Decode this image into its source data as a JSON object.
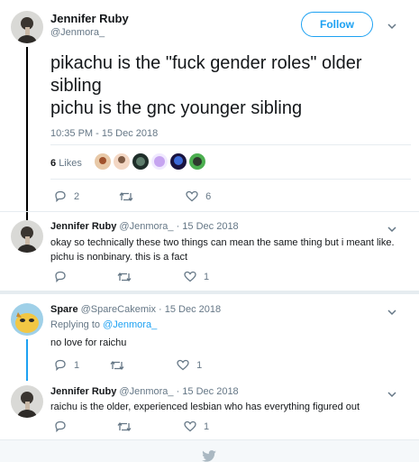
{
  "tweet": {
    "author_name": "Jennifer Ruby",
    "author_handle": "@Jenmora_",
    "follow_label": "Follow",
    "text_lines": [
      "pikachu is the \"fuck gender roles\" older",
      "sibling",
      "pichu is the gnc younger sibling"
    ],
    "timestamp": "10:35 PM - 15 Dec 2018",
    "likes_count": "6",
    "likes_label": "Likes",
    "reply_count": "2",
    "like_count": "6",
    "liker_avatars": [
      "avatar-1",
      "avatar-2",
      "avatar-3",
      "avatar-4",
      "avatar-5",
      "avatar-6"
    ]
  },
  "replies": [
    {
      "author_name": "Jennifer Ruby",
      "author_handle": "@Jenmora_",
      "date": "· 15 Dec 2018",
      "lines": [
        "okay so technically these two things can mean the same thing but i meant like.",
        "pichu is nonbinary. this is a fact"
      ],
      "like_count": "1"
    },
    {
      "author_name": "Spare",
      "author_handle": "@SpareCakemix",
      "date": "· 15 Dec 2018",
      "replying_label": "Replying to",
      "replying_to": "@Jenmora_",
      "lines": [
        "no love for raichu"
      ],
      "reply_count": "1",
      "like_count": "1"
    },
    {
      "author_name": "Jennifer Ruby",
      "author_handle": "@Jenmora_",
      "date": "· 15 Dec 2018",
      "lines": [
        "raichu is the older, experienced lesbian who has everything figured out"
      ],
      "like_count": "1"
    }
  ],
  "colors": {
    "accent": "#1da1f2",
    "thread_dark": "#000000",
    "thread_blue": "#1da1f2",
    "muted": "#657786"
  },
  "icons": {
    "reply": "reply-icon",
    "retweet": "retweet-icon",
    "like": "heart-icon",
    "caret": "chevron-down-icon",
    "footer": "twitter-bird-icon"
  }
}
